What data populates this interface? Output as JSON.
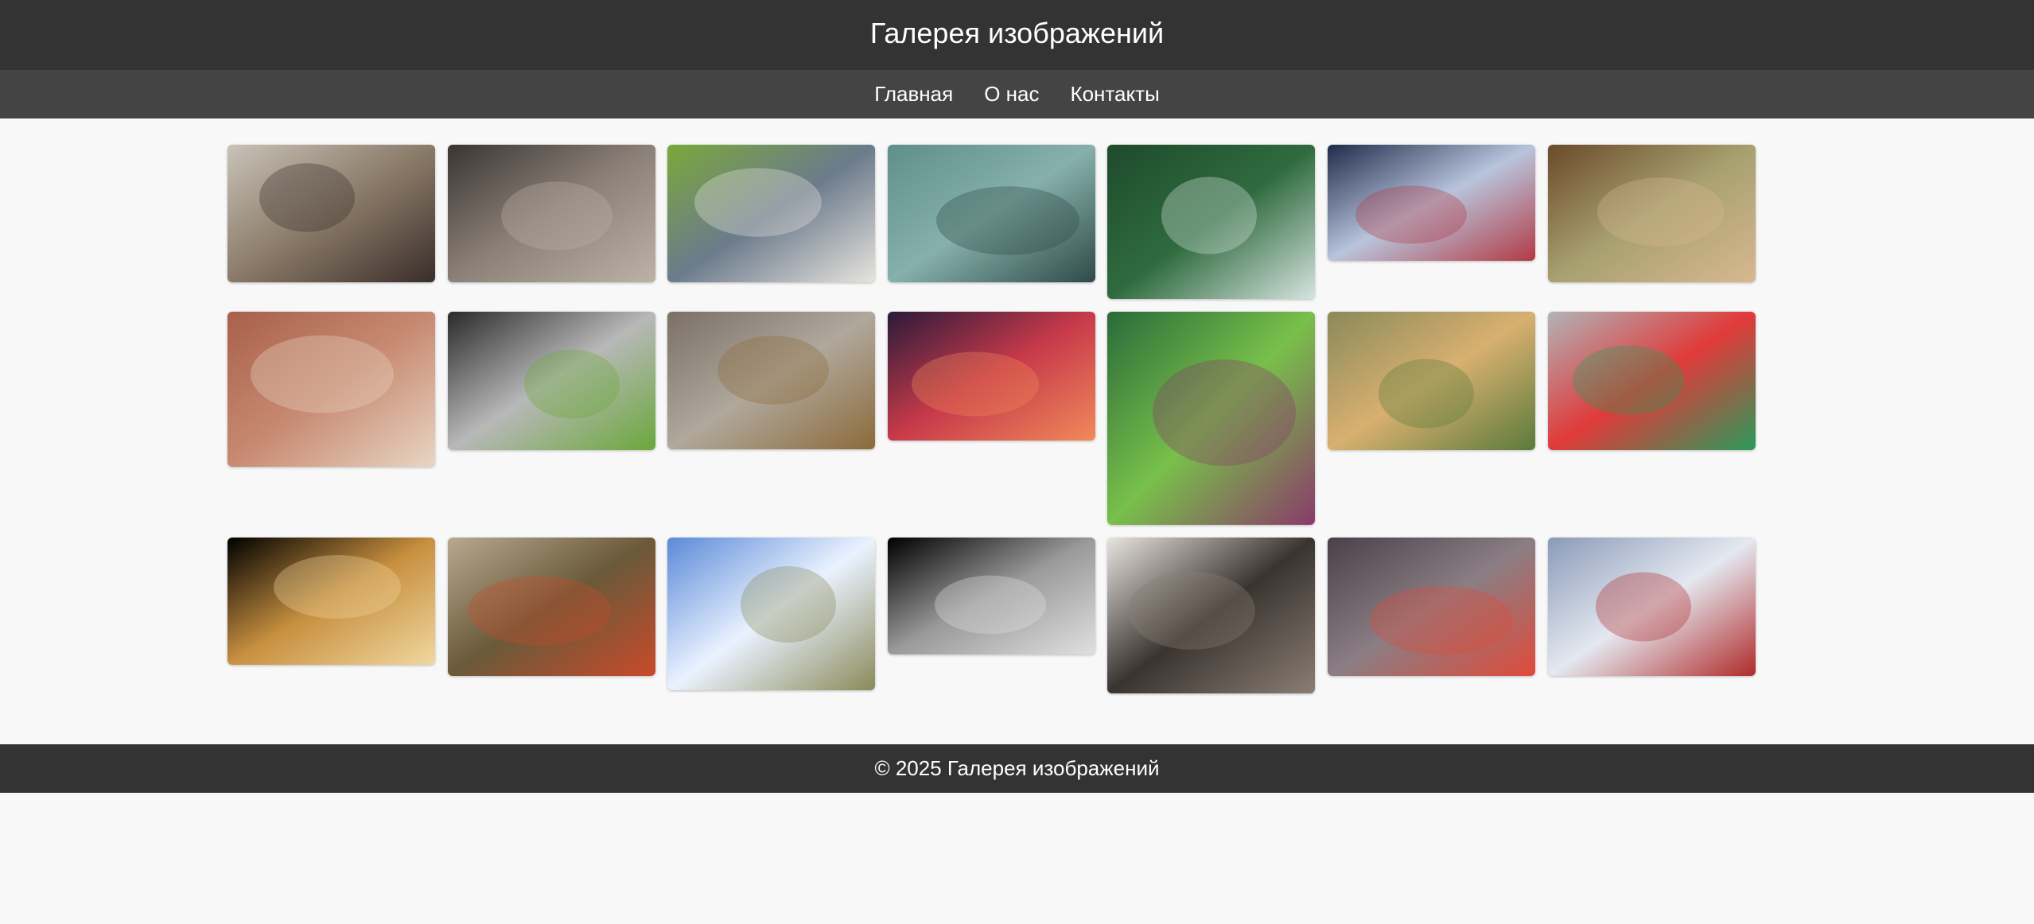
{
  "header": {
    "title": "Галерея изображений"
  },
  "nav": {
    "items": [
      {
        "label": "Главная"
      },
      {
        "label": "О нас"
      },
      {
        "label": "Контакты"
      }
    ]
  },
  "footer": {
    "text": "© 2025 Галерея изображений"
  },
  "gallery": {
    "images": [
      {
        "name": "cat-with-sunglasses",
        "palette": [
          "#c9c3b8",
          "#8a7a68",
          "#3a2e2a"
        ]
      },
      {
        "name": "stone-statue-faces",
        "palette": [
          "#3a3532",
          "#8c8178",
          "#bdb2a6"
        ]
      },
      {
        "name": "mountain-chapel",
        "palette": [
          "#7aa83a",
          "#6b7b8c",
          "#e8e4de"
        ]
      },
      {
        "name": "cobblestone-manholes",
        "palette": [
          "#5f8f8a",
          "#86b0ab",
          "#2e4a48"
        ]
      },
      {
        "name": "airplane-over-forest",
        "palette": [
          "#1e4a2c",
          "#2f6b3e",
          "#d6e4e0"
        ]
      },
      {
        "name": "striped-hair-portrait",
        "palette": [
          "#1f2b4a",
          "#b8c4dc",
          "#b23a44"
        ]
      },
      {
        "name": "giraffe-neck",
        "palette": [
          "#6b4a2a",
          "#a8a070",
          "#d8b890"
        ]
      },
      {
        "name": "brick-pavement-leaves",
        "palette": [
          "#a8604a",
          "#c88a72",
          "#e8d6c4"
        ]
      },
      {
        "name": "grass-in-sand",
        "palette": [
          "#2a2a2a",
          "#b8b8b8",
          "#6aa83a"
        ]
      },
      {
        "name": "dogs-on-bridge",
        "palette": [
          "#7a7066",
          "#b0a89c",
          "#8c6a3a"
        ]
      },
      {
        "name": "tree-at-sunset",
        "palette": [
          "#2a1a3a",
          "#c83a4a",
          "#f08a5a"
        ]
      },
      {
        "name": "poppy-bud",
        "palette": [
          "#2a6a3a",
          "#78c04a",
          "#8a3a6a"
        ]
      },
      {
        "name": "golden-puppy",
        "palette": [
          "#8a8a5a",
          "#d8b070",
          "#5a7a3a"
        ]
      },
      {
        "name": "colorful-ropes",
        "palette": [
          "#b0b4b8",
          "#e03a3a",
          "#2a9a5a"
        ]
      },
      {
        "name": "golden-twisted-rope",
        "palette": [
          "#000000",
          "#c89040",
          "#f0d8a0"
        ]
      },
      {
        "name": "ornate-shop-sign",
        "palette": [
          "#b8a890",
          "#6a5a3a",
          "#c84a2a"
        ]
      },
      {
        "name": "arch-sculpture-sky",
        "palette": [
          "#5a8ad8",
          "#eaf2ff",
          "#8a8a5a"
        ]
      },
      {
        "name": "metal-knot",
        "palette": [
          "#000000",
          "#9a9a9a",
          "#e0e0e0"
        ]
      },
      {
        "name": "book-heart-pages",
        "palette": [
          "#e8e4e0",
          "#3a3430",
          "#8a7e74"
        ]
      },
      {
        "name": "kayak-on-water",
        "palette": [
          "#4a4048",
          "#8a7e84",
          "#e04a3a"
        ]
      },
      {
        "name": "snowy-mountain-hiker",
        "palette": [
          "#8a9ab8",
          "#e4e8f0",
          "#b02a2a"
        ]
      }
    ]
  }
}
